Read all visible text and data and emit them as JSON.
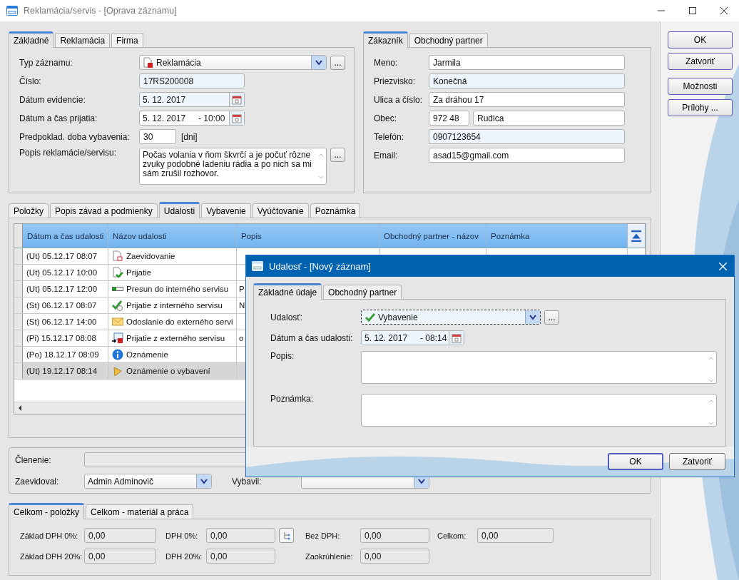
{
  "window": {
    "title": "Reklamácia/servis - [Oprava záznamu]"
  },
  "main_tabs": [
    {
      "label": "Základné",
      "selected": true
    },
    {
      "label": "Reklamácia",
      "selected": false
    },
    {
      "label": "Firma",
      "selected": false
    }
  ],
  "record": {
    "type": {
      "label": "Typ záznamu:",
      "value": "Reklamácia",
      "button": "..."
    },
    "number": {
      "label": "Číslo:",
      "value": "17RS200008"
    },
    "registered": {
      "label": "Dátum evidencie:",
      "date": "5. 12. 2017"
    },
    "received": {
      "label": "Dátum a čas prijatia:",
      "date": "5. 12. 2017",
      "time": "- 10:00"
    },
    "duration": {
      "label": "Predpoklad. doba vybavenia:",
      "value": "30",
      "unit": "[dni]"
    },
    "description": {
      "label": "Popis reklamácie/servisu:",
      "value": "Počas volania v ňom škvrčí a je počuť rôzne zvuky podobné ladeniu rádia a po nich sa mi sám zrušil rozhovor.",
      "button": "..."
    }
  },
  "customer_tabs": [
    {
      "label": "Zákazník",
      "selected": true
    },
    {
      "label": "Obchodný partner",
      "selected": false
    }
  ],
  "customer": [
    {
      "label": "Meno:",
      "values": [
        "Jarmila"
      ],
      "highlighted": false
    },
    {
      "label": "Priezvisko:",
      "values": [
        "Konečná"
      ],
      "highlighted": true
    },
    {
      "label": "Ulica a číslo:",
      "values": [
        "Za dráhou 17"
      ],
      "highlighted": false
    },
    {
      "label": "Obec:",
      "values": [
        "972 48",
        "Rudica"
      ],
      "highlighted": false
    },
    {
      "label": "Telefón:",
      "values": [
        "0907123654"
      ],
      "highlighted": true
    },
    {
      "label": "Email:",
      "values": [
        "asad15@gmail.com"
      ],
      "highlighted": false
    }
  ],
  "side_buttons": [
    "OK",
    "Zatvoriť",
    "Možnosti",
    "Prílohy ..."
  ],
  "detail_tabs": [
    {
      "label": "Položky",
      "selected": false
    },
    {
      "label": "Popis závad a podmienky",
      "selected": false
    },
    {
      "label": "Udalosti",
      "selected": true
    },
    {
      "label": "Vybavenie",
      "selected": false
    },
    {
      "label": "Vyúčtovanie",
      "selected": false
    },
    {
      "label": "Poznámka",
      "selected": false
    }
  ],
  "events_table": {
    "columns": [
      "Dátum a čas udalosti",
      "Názov udalosti",
      "Popis",
      "Obchodný partner - názov",
      "Poznámka"
    ],
    "rows": [
      {
        "date": "(Ut) 05.12.17 08:07",
        "name": "Zaevidovanie",
        "kind": "document",
        "selected": false
      },
      {
        "date": "(Ut) 05.12.17 10:00",
        "name": "Prijatie",
        "kind": "receive",
        "selected": false
      },
      {
        "date": "(Ut) 05.12.17 12:00",
        "name": "Presun do interného servisu",
        "kind": "transfer",
        "description": "P",
        "selected": false
      },
      {
        "date": "(St) 06.12.17 08:07",
        "name": "Prijatie z interného servisu",
        "kind": "check",
        "description": "N",
        "selected": false
      },
      {
        "date": "(St) 06.12.17 14:00",
        "name": "Odoslanie do externého servi",
        "kind": "mail",
        "selected": false
      },
      {
        "date": "(Pi) 15.12.17 08:08",
        "name": "Prijatie z externého servisu",
        "kind": "mail-in",
        "description": "o",
        "selected": false
      },
      {
        "date": "(Po) 18.12.17 08:09",
        "name": "Oznámenie",
        "kind": "info",
        "selected": false
      },
      {
        "date": "(Ut) 19.12.17 08:14",
        "name": "Oznámenie o vybavení",
        "kind": "bell",
        "selected": true
      }
    ]
  },
  "assignment": {
    "division": {
      "label": "Členenie:"
    },
    "registered_by": {
      "label": "Zaevidoval:",
      "value": "Admin Adminovič"
    },
    "resolved_by": {
      "label": "Vybavil:"
    }
  },
  "totals_tabs": [
    {
      "label": "Celkom - položky",
      "selected": true
    },
    {
      "label": "Celkom - materiál a práca",
      "selected": false
    }
  ],
  "totals": [
    [
      {
        "label": "Základ DPH 0%:",
        "value": "0,00",
        "kind": "plain"
      },
      {
        "label": "DPH 0%:",
        "value": "0,00",
        "kind": "with-button"
      },
      {
        "label": "Bez DPH:",
        "value": "0,00",
        "kind": "plain"
      },
      {
        "label": "Celkom:",
        "value": "0,00",
        "kind": "plain"
      }
    ],
    [
      {
        "label": "Základ DPH 20%:",
        "value": "0,00",
        "kind": "plain"
      },
      {
        "label": "DPH 20%:",
        "value": "0,00",
        "kind": "plain"
      },
      {
        "label": "Zaokrúhlenie:",
        "value": "0,00",
        "kind": "plain"
      }
    ]
  ],
  "dialog": {
    "title": "Udalosť - [Nový záznam]",
    "tabs": [
      {
        "label": "Základné údaje",
        "selected": true
      },
      {
        "label": "Obchodný partner",
        "selected": false
      }
    ],
    "event": {
      "label": "Udalosť:",
      "value": "Vybavenie",
      "button": "..."
    },
    "datetime": {
      "label": "Dátum a čas udalosti:",
      "date": "5. 12. 2017",
      "time": "- 08:14"
    },
    "description": {
      "label": "Popis:"
    },
    "note": {
      "label": "Poznámka:"
    },
    "buttons": [
      "OK",
      "Zatvoriť"
    ]
  }
}
